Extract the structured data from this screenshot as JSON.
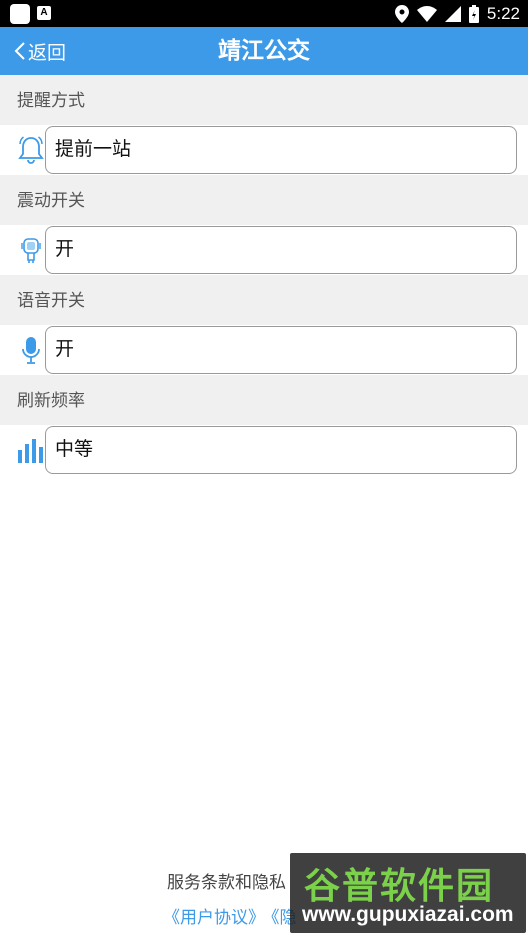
{
  "statusbar": {
    "time": "5:22",
    "icons": [
      "app-square-icon",
      "a-notification-icon",
      "location-icon",
      "wifi-icon",
      "signal-icon",
      "battery-icon"
    ]
  },
  "header": {
    "back_label": "返回",
    "title": "靖江公交"
  },
  "settings": [
    {
      "label": "提醒方式",
      "value": "提前一站",
      "icon": "bell-icon"
    },
    {
      "label": "震动开关",
      "value": "开",
      "icon": "vibrate-icon"
    },
    {
      "label": "语音开关",
      "value": "开",
      "icon": "microphone-icon"
    },
    {
      "label": "刷新频率",
      "value": "中等",
      "icon": "signal-bars-icon"
    }
  ],
  "footer": {
    "text": "服务条款和隐私",
    "link_user_agreement": "《用户协议》",
    "link_privacy_partial": "《隐"
  },
  "watermark": {
    "title": "谷普软件园",
    "url": "www.gupuxiazai.com"
  },
  "colors": {
    "accent": "#3d9ae8",
    "section_bg": "#f0f0f0",
    "watermark_green": "#7bd14a"
  }
}
